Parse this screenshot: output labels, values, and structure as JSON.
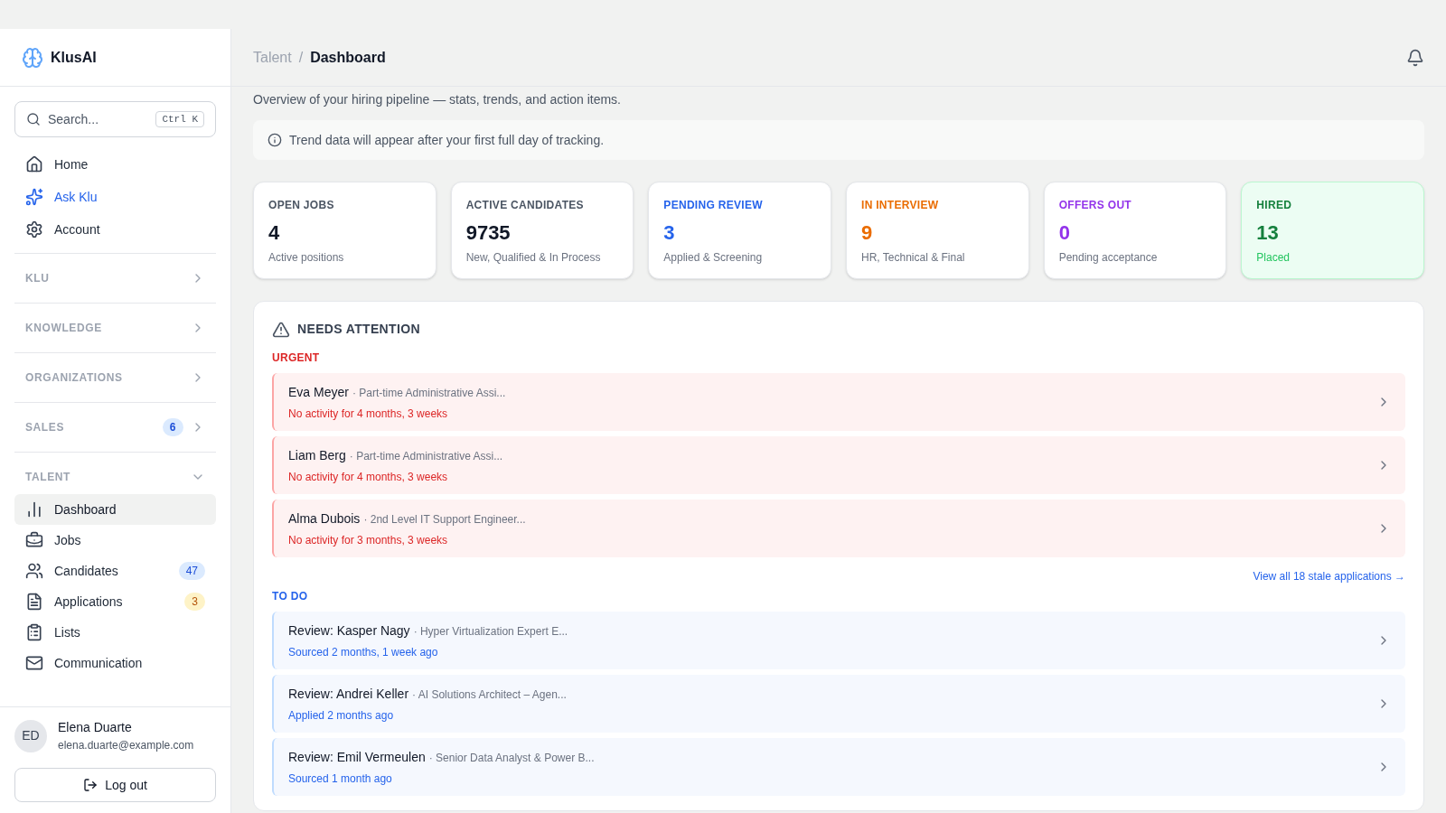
{
  "sidebar": {
    "brand": "KlusAI",
    "search": {
      "placeholder": "Search...",
      "shortcut": "Ctrl K"
    },
    "main_items": [
      {
        "label": "Home",
        "kind": "plain"
      },
      {
        "label": "Ask Klu",
        "kind": "ai"
      },
      {
        "label": "Account",
        "kind": "plain"
      }
    ],
    "sections": [
      {
        "label": "KLU",
        "expanded": false
      },
      {
        "label": "KNOWLEDGE",
        "expanded": false
      },
      {
        "label": "ORGANIZATIONS",
        "expanded": false
      },
      {
        "label": "SALES",
        "expanded": false,
        "badge": {
          "text": "6",
          "kind": "info"
        }
      },
      {
        "label": "TALENT",
        "expanded": true,
        "items": [
          {
            "label": "Dashboard",
            "selected": true
          },
          {
            "label": "Jobs",
            "selected": false
          },
          {
            "label": "Candidates",
            "selected": false,
            "badge": {
              "text": "47",
              "kind": "info"
            }
          },
          {
            "label": "Applications",
            "selected": false,
            "badge": {
              "text": "3",
              "kind": "warning"
            }
          },
          {
            "label": "Lists",
            "selected": false
          },
          {
            "label": "Communication",
            "selected": false
          }
        ]
      }
    ],
    "user": {
      "initials": "ED",
      "name": "Elena Duarte",
      "email": "elena.duarte@example.com"
    },
    "logout": "Log out"
  },
  "header": {
    "breadcrumb": [
      "Talent",
      "Dashboard"
    ],
    "separator": "/"
  },
  "subtitle": "Overview of your hiring pipeline — stats, trends, and action items.",
  "notice": "Trend data will appear after your first full day of tracking.",
  "stats": [
    {
      "label": "OPEN JOBS",
      "value": "4",
      "caption": "Active positions",
      "kind": "neutral"
    },
    {
      "label": "ACTIVE CANDIDATES",
      "value": "9735",
      "caption": "New, Qualified & In Process",
      "kind": "neutral"
    },
    {
      "label": "PENDING REVIEW",
      "value": "3",
      "caption": "Applied & Screening",
      "kind": "blue"
    },
    {
      "label": "IN INTERVIEW",
      "value": "9",
      "caption": "HR, Technical & Final",
      "kind": "orange"
    },
    {
      "label": "OFFERS OUT",
      "value": "0",
      "caption": "Pending acceptance",
      "kind": "purple"
    },
    {
      "label": "HIRED",
      "value": "13",
      "caption": "Placed",
      "kind": "green"
    }
  ],
  "attention": {
    "title": "NEEDS ATTENTION",
    "groups": [
      {
        "label": "URGENT",
        "kind": "urgent",
        "link": "View all 18 stale applications →",
        "items": [
          {
            "title": "Eva Meyer",
            "detail": "· Part-time Administrative Assi...",
            "status": "No activity for 4 months, 3 weeks"
          },
          {
            "title": "Liam Berg",
            "detail": "· Part-time Administrative Assi...",
            "status": "No activity for 4 months, 3 weeks"
          },
          {
            "title": "Alma Dubois",
            "detail": "· 2nd Level IT Support Engineer...",
            "status": "No activity for 3 months, 3 weeks"
          }
        ]
      },
      {
        "label": "TO DO",
        "kind": "todo",
        "items": [
          {
            "title": "Review: Kasper Nagy",
            "detail": "· Hyper Virtualization Expert E...",
            "status": "Sourced 2 months, 1 week ago"
          },
          {
            "title": "Review: Andrei Keller",
            "detail": "· AI Solutions Architect – Agen...",
            "status": "Applied 2 months ago"
          },
          {
            "title": "Review: Emil Vermeulen",
            "detail": "· Senior Data Analyst & Power B...",
            "status": "Sourced 1 month ago"
          }
        ]
      }
    ]
  }
}
